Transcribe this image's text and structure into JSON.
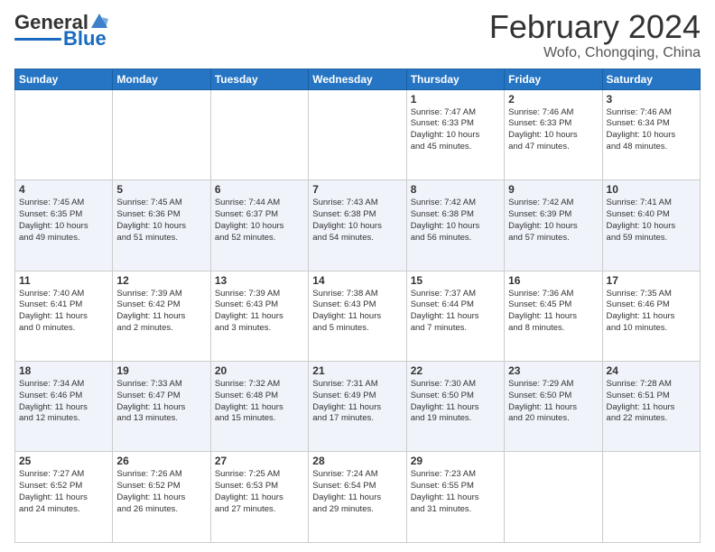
{
  "header": {
    "logo_general": "General",
    "logo_blue": "Blue",
    "title": "February 2024",
    "subtitle": "Wofo, Chongqing, China"
  },
  "days_of_week": [
    "Sunday",
    "Monday",
    "Tuesday",
    "Wednesday",
    "Thursday",
    "Friday",
    "Saturday"
  ],
  "weeks": [
    [
      {
        "day": "",
        "info": ""
      },
      {
        "day": "",
        "info": ""
      },
      {
        "day": "",
        "info": ""
      },
      {
        "day": "",
        "info": ""
      },
      {
        "day": "1",
        "info": "Sunrise: 7:47 AM\nSunset: 6:33 PM\nDaylight: 10 hours\nand 45 minutes."
      },
      {
        "day": "2",
        "info": "Sunrise: 7:46 AM\nSunset: 6:33 PM\nDaylight: 10 hours\nand 47 minutes."
      },
      {
        "day": "3",
        "info": "Sunrise: 7:46 AM\nSunset: 6:34 PM\nDaylight: 10 hours\nand 48 minutes."
      }
    ],
    [
      {
        "day": "4",
        "info": "Sunrise: 7:45 AM\nSunset: 6:35 PM\nDaylight: 10 hours\nand 49 minutes."
      },
      {
        "day": "5",
        "info": "Sunrise: 7:45 AM\nSunset: 6:36 PM\nDaylight: 10 hours\nand 51 minutes."
      },
      {
        "day": "6",
        "info": "Sunrise: 7:44 AM\nSunset: 6:37 PM\nDaylight: 10 hours\nand 52 minutes."
      },
      {
        "day": "7",
        "info": "Sunrise: 7:43 AM\nSunset: 6:38 PM\nDaylight: 10 hours\nand 54 minutes."
      },
      {
        "day": "8",
        "info": "Sunrise: 7:42 AM\nSunset: 6:38 PM\nDaylight: 10 hours\nand 56 minutes."
      },
      {
        "day": "9",
        "info": "Sunrise: 7:42 AM\nSunset: 6:39 PM\nDaylight: 10 hours\nand 57 minutes."
      },
      {
        "day": "10",
        "info": "Sunrise: 7:41 AM\nSunset: 6:40 PM\nDaylight: 10 hours\nand 59 minutes."
      }
    ],
    [
      {
        "day": "11",
        "info": "Sunrise: 7:40 AM\nSunset: 6:41 PM\nDaylight: 11 hours\nand 0 minutes."
      },
      {
        "day": "12",
        "info": "Sunrise: 7:39 AM\nSunset: 6:42 PM\nDaylight: 11 hours\nand 2 minutes."
      },
      {
        "day": "13",
        "info": "Sunrise: 7:39 AM\nSunset: 6:43 PM\nDaylight: 11 hours\nand 3 minutes."
      },
      {
        "day": "14",
        "info": "Sunrise: 7:38 AM\nSunset: 6:43 PM\nDaylight: 11 hours\nand 5 minutes."
      },
      {
        "day": "15",
        "info": "Sunrise: 7:37 AM\nSunset: 6:44 PM\nDaylight: 11 hours\nand 7 minutes."
      },
      {
        "day": "16",
        "info": "Sunrise: 7:36 AM\nSunset: 6:45 PM\nDaylight: 11 hours\nand 8 minutes."
      },
      {
        "day": "17",
        "info": "Sunrise: 7:35 AM\nSunset: 6:46 PM\nDaylight: 11 hours\nand 10 minutes."
      }
    ],
    [
      {
        "day": "18",
        "info": "Sunrise: 7:34 AM\nSunset: 6:46 PM\nDaylight: 11 hours\nand 12 minutes."
      },
      {
        "day": "19",
        "info": "Sunrise: 7:33 AM\nSunset: 6:47 PM\nDaylight: 11 hours\nand 13 minutes."
      },
      {
        "day": "20",
        "info": "Sunrise: 7:32 AM\nSunset: 6:48 PM\nDaylight: 11 hours\nand 15 minutes."
      },
      {
        "day": "21",
        "info": "Sunrise: 7:31 AM\nSunset: 6:49 PM\nDaylight: 11 hours\nand 17 minutes."
      },
      {
        "day": "22",
        "info": "Sunrise: 7:30 AM\nSunset: 6:50 PM\nDaylight: 11 hours\nand 19 minutes."
      },
      {
        "day": "23",
        "info": "Sunrise: 7:29 AM\nSunset: 6:50 PM\nDaylight: 11 hours\nand 20 minutes."
      },
      {
        "day": "24",
        "info": "Sunrise: 7:28 AM\nSunset: 6:51 PM\nDaylight: 11 hours\nand 22 minutes."
      }
    ],
    [
      {
        "day": "25",
        "info": "Sunrise: 7:27 AM\nSunset: 6:52 PM\nDaylight: 11 hours\nand 24 minutes."
      },
      {
        "day": "26",
        "info": "Sunrise: 7:26 AM\nSunset: 6:52 PM\nDaylight: 11 hours\nand 26 minutes."
      },
      {
        "day": "27",
        "info": "Sunrise: 7:25 AM\nSunset: 6:53 PM\nDaylight: 11 hours\nand 27 minutes."
      },
      {
        "day": "28",
        "info": "Sunrise: 7:24 AM\nSunset: 6:54 PM\nDaylight: 11 hours\nand 29 minutes."
      },
      {
        "day": "29",
        "info": "Sunrise: 7:23 AM\nSunset: 6:55 PM\nDaylight: 11 hours\nand 31 minutes."
      },
      {
        "day": "",
        "info": ""
      },
      {
        "day": "",
        "info": ""
      }
    ]
  ]
}
